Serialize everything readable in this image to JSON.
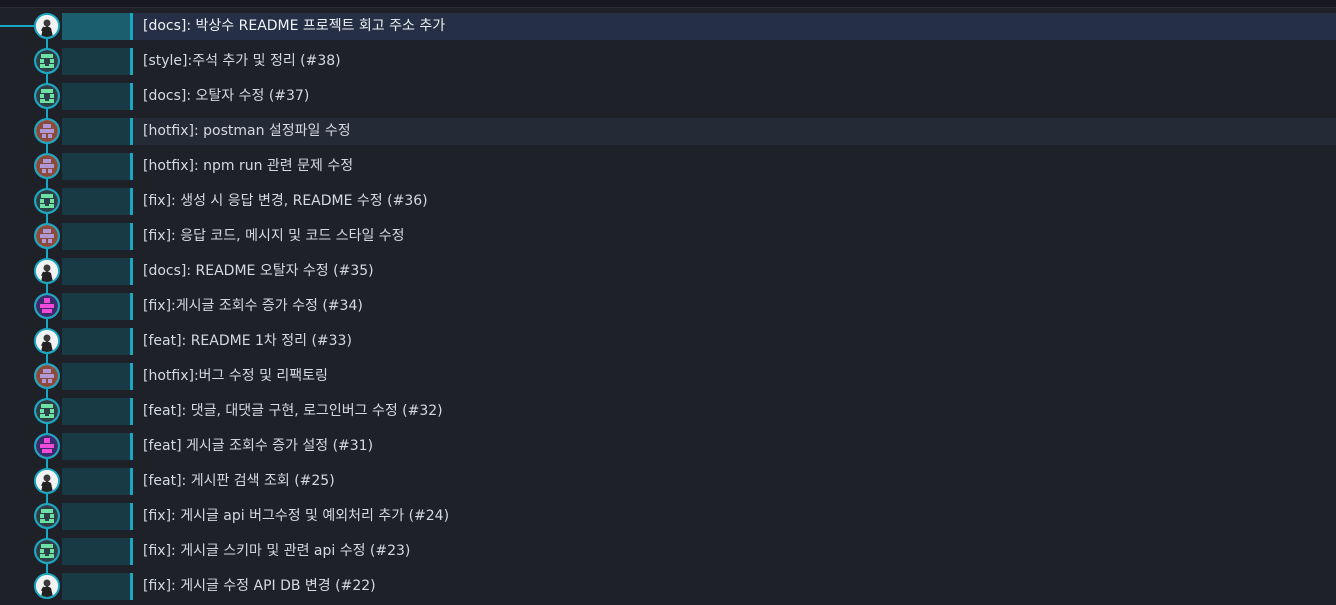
{
  "theme": {
    "accent": "#19a8c4",
    "selected_bg": "#253046",
    "bg": "#1e2127"
  },
  "commits": [
    {
      "message": "[docs]: 박상수 README 프로젝트 회고 주소 추가",
      "avatar": "photo-avatar"
    },
    {
      "message": "[style]:주석 추가 및 정리 (#38)",
      "avatar": "green-identicon"
    },
    {
      "message": "[docs]: 오탈자 수정 (#37)",
      "avatar": "green-identicon"
    },
    {
      "message": "[hotfix]: postman 설정파일 수정",
      "avatar": "brown-identicon"
    },
    {
      "message": "[hotfix]: npm run 관련 문제 수정",
      "avatar": "brown-identicon"
    },
    {
      "message": "[fix]: 생성 시 응답 변경, README 수정 (#36)",
      "avatar": "green-identicon"
    },
    {
      "message": "[fix]: 응답 코드, 메시지 및 코드 스타일 수정",
      "avatar": "brown-identicon"
    },
    {
      "message": "[docs]: README 오탈자 수정 (#35)",
      "avatar": "photo-avatar"
    },
    {
      "message": "[fix]:게시글 조회수 증가 수정 (#34)",
      "avatar": "purple-identicon"
    },
    {
      "message": "[feat]: README 1차 정리 (#33)",
      "avatar": "photo-avatar"
    },
    {
      "message": "[hotfix]:버그 수정 및 리팩토링",
      "avatar": "brown-identicon"
    },
    {
      "message": "[feat]: 댓글, 대댓글 구현, 로그인버그 수정 (#32)",
      "avatar": "green-identicon"
    },
    {
      "message": "[feat] 게시글 조회수 증가 설정 (#31)",
      "avatar": "purple-identicon"
    },
    {
      "message": "[feat]: 게시판 검색 조회 (#25)",
      "avatar": "photo-avatar"
    },
    {
      "message": "[fix]: 게시글 api 버그수정 및 예외처리 추가 (#24)",
      "avatar": "green-identicon"
    },
    {
      "message": "[fix]: 게시글 스키마 및 관련 api 수정 (#23)",
      "avatar": "green-identicon"
    },
    {
      "message": "[fix]: 게시글 수정 API DB 변경 (#22)",
      "avatar": "photo-avatar"
    }
  ]
}
